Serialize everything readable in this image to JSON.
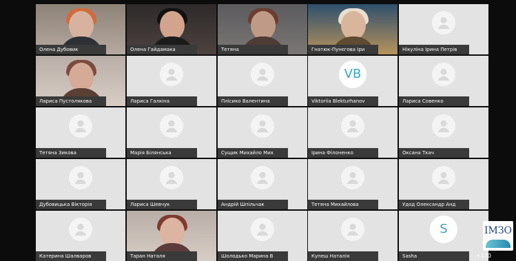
{
  "participants": [
    {
      "name": "Олена Дубовик"
    },
    {
      "name": "Олена Гайдамака"
    },
    {
      "name": "Тетяна"
    },
    {
      "name": "Гнатюк-Пунєгова Іри"
    },
    {
      "name": "Нікуліна Ірина Петрів"
    },
    {
      "name": "Лариса Пустолякова"
    },
    {
      "name": "Лариса Галкіна"
    },
    {
      "name": "Плісико Валентина"
    },
    {
      "name": "Viktoriia Blekturhanov",
      "initials": "VB"
    },
    {
      "name": "Лариса Совенко"
    },
    {
      "name": "Тетяна Зикова"
    },
    {
      "name": "Марія Білянська"
    },
    {
      "name": "Сущик Михайло Мих"
    },
    {
      "name": "Ірина Філоненко"
    },
    {
      "name": "Оксана Ткач"
    },
    {
      "name": "Дубовицька Вікторія"
    },
    {
      "name": "Лариса Шевчук"
    },
    {
      "name": "Андрій Шпільчак"
    },
    {
      "name": "Тетяна Михайлова"
    },
    {
      "name": "Удод Олександр Анд"
    },
    {
      "name": "Катерина Шалваров"
    },
    {
      "name": "Таран Наталя"
    },
    {
      "name": "Шолодько Марина В"
    },
    {
      "name": "Купеш Наталія"
    },
    {
      "name": "Sasha",
      "initials": "S"
    }
  ],
  "overflow_count": "+130",
  "logo_text": "ІМЗО"
}
